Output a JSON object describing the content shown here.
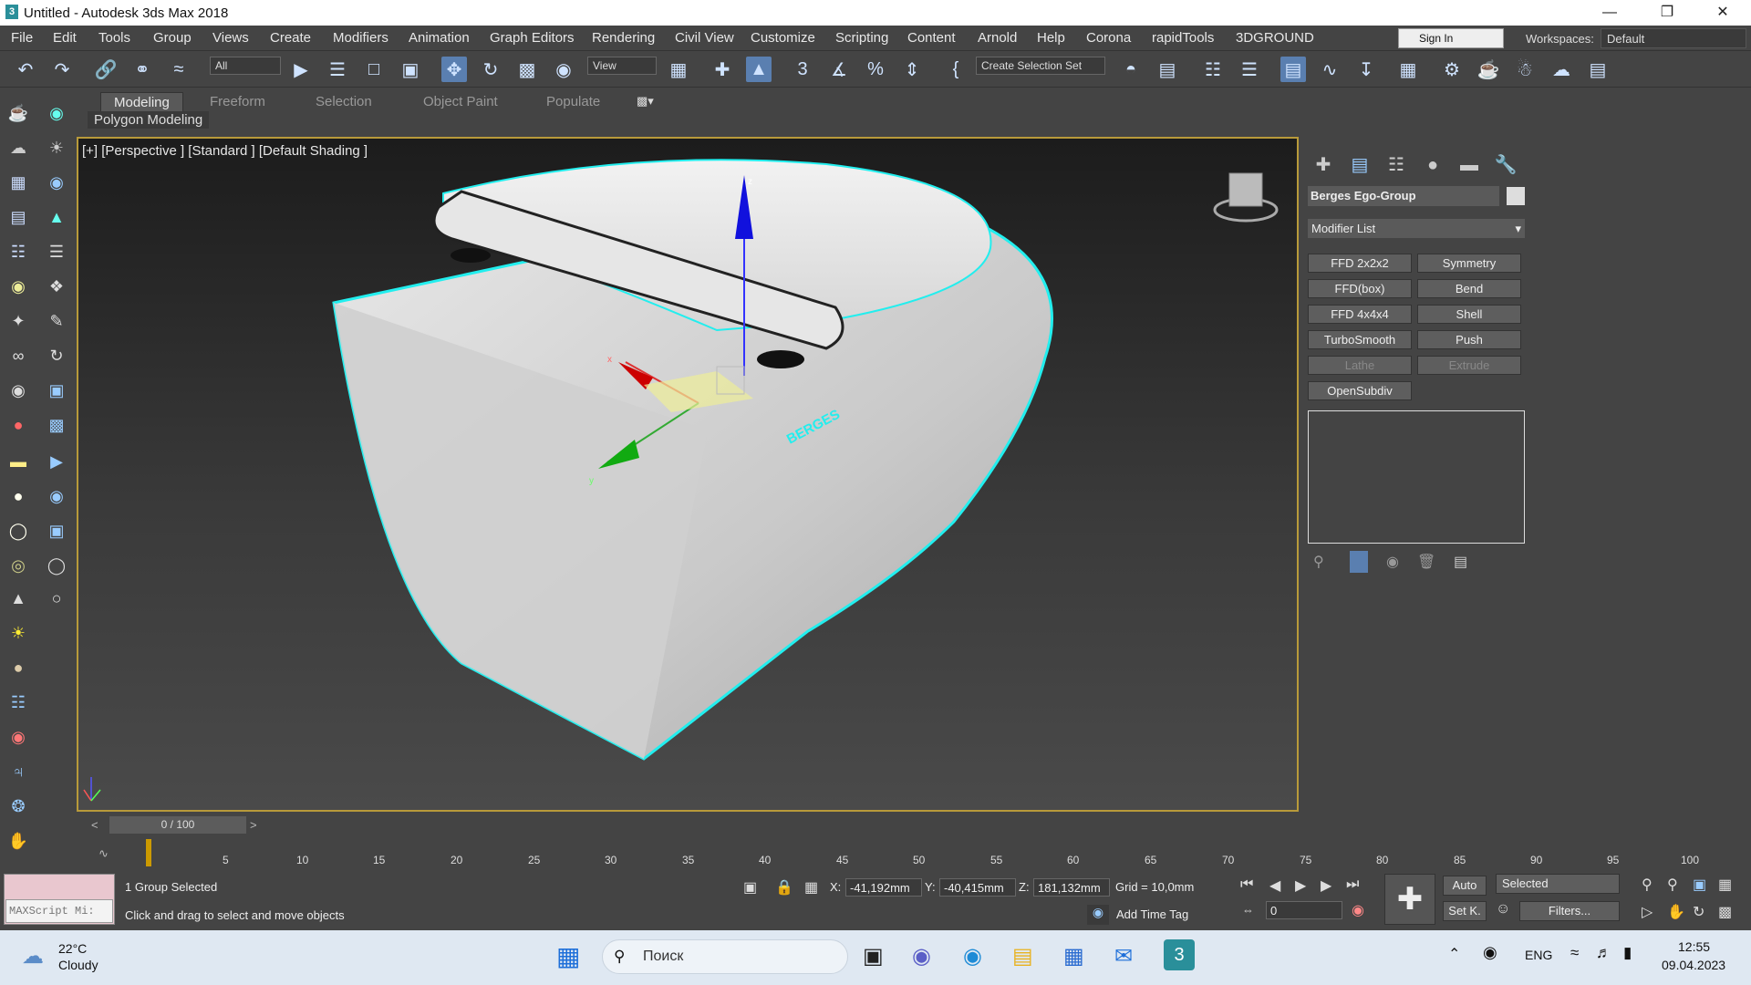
{
  "window": {
    "title": "Untitled - Autodesk 3ds Max 2018",
    "app_icon_text": "3"
  },
  "menu": [
    "File",
    "Edit",
    "Tools",
    "Group",
    "Views",
    "Create",
    "Modifiers",
    "Animation",
    "Graph Editors",
    "Rendering",
    "Civil View",
    "Customize",
    "Scripting",
    "Content",
    "Arnold",
    "Help",
    "Corona",
    "rapidTools",
    "3DGROUND"
  ],
  "signin": "Sign In",
  "workspaces": {
    "label": "Workspaces:",
    "value": "Default"
  },
  "toolbar": {
    "filter": "All",
    "refcoord": "View",
    "selection_set": "Create Selection Set"
  },
  "ribbon": {
    "tabs": [
      "Modeling",
      "Freeform",
      "Selection",
      "Object Paint",
      "Populate"
    ],
    "active": "Modeling",
    "sub_label": "Polygon Modeling"
  },
  "viewport": {
    "label": "[+] [Perspective ] [Standard ] [Default Shading ]",
    "logo_text": "BERGES"
  },
  "command_panel": {
    "object_name": "Berges Ego-Group",
    "modifier_list": "Modifier List",
    "buttons": [
      [
        "FFD 2x2x2",
        "Symmetry"
      ],
      [
        "FFD(box)",
        "Bend"
      ],
      [
        "FFD 4x4x4",
        "Shell"
      ],
      [
        "TurboSmooth",
        "Push"
      ],
      [
        "Lathe",
        "Extrude"
      ],
      [
        "OpenSubdiv",
        ""
      ]
    ],
    "dim_buttons": [
      "Lathe",
      "Extrude"
    ]
  },
  "timeline": {
    "counter": "0 / 100",
    "ticks": [
      "5",
      "10",
      "15",
      "20",
      "25",
      "30",
      "35",
      "40",
      "45",
      "50",
      "55",
      "60",
      "65",
      "70",
      "75",
      "80",
      "85",
      "90",
      "95",
      "100"
    ],
    "current_frame": "0"
  },
  "status": {
    "maxscript": "MAXScript Mi:",
    "selected": "1 Group Selected",
    "prompt": "Click and drag to select and move objects",
    "x": "-41,192mm",
    "y": "-40,415mm",
    "z": "181,132mm",
    "grid": "Grid = 10,0mm",
    "add_time_tag": "Add Time Tag",
    "auto": "Auto",
    "set_key": "Set K.",
    "selected_dropdown": "Selected",
    "filters": "Filters..."
  },
  "taskbar": {
    "temp": "22°C",
    "weather": "Cloudy",
    "search": "Поиск",
    "lang": "ENG",
    "time": "12:55",
    "date": "09.04.2023"
  }
}
